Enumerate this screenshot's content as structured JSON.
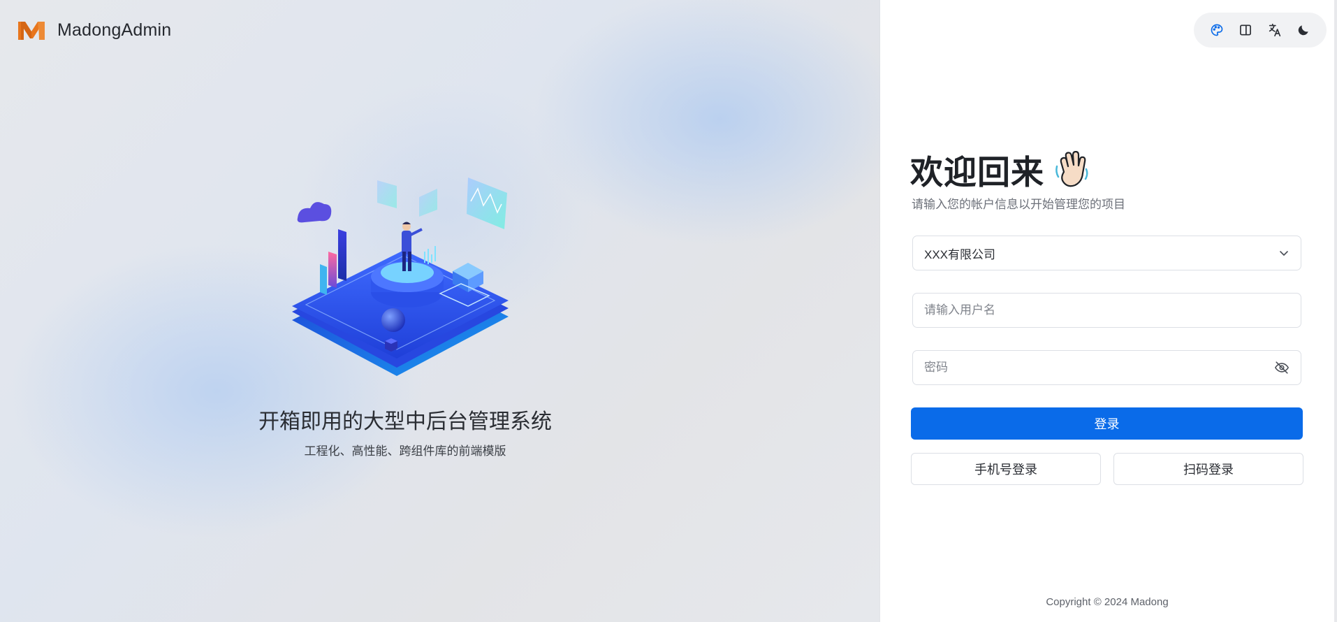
{
  "brand": {
    "name": "MadongAdmin"
  },
  "hero": {
    "title": "开箱即用的大型中后台管理系统",
    "subtitle": "工程化、高性能、跨组件库的前端模版"
  },
  "toolbar": {
    "icons": [
      "palette-icon",
      "layout-panel-icon",
      "translate-icon",
      "moon-icon"
    ],
    "accent_color": "#0a6be9"
  },
  "login": {
    "title": "欢迎回来",
    "subtitle": "请输入您的帐户信息以开始管理您的项目",
    "company_select_value": "XXX有限公司",
    "username_placeholder": "请输入用户名",
    "password_placeholder": "密码",
    "submit_label": "登录",
    "phone_login_label": "手机号登录",
    "qr_login_label": "扫码登录"
  },
  "footer": {
    "copyright": "Copyright © 2024 Madong"
  },
  "colors": {
    "primary": "#0a6be9",
    "logo_orange": "#e8761d"
  }
}
